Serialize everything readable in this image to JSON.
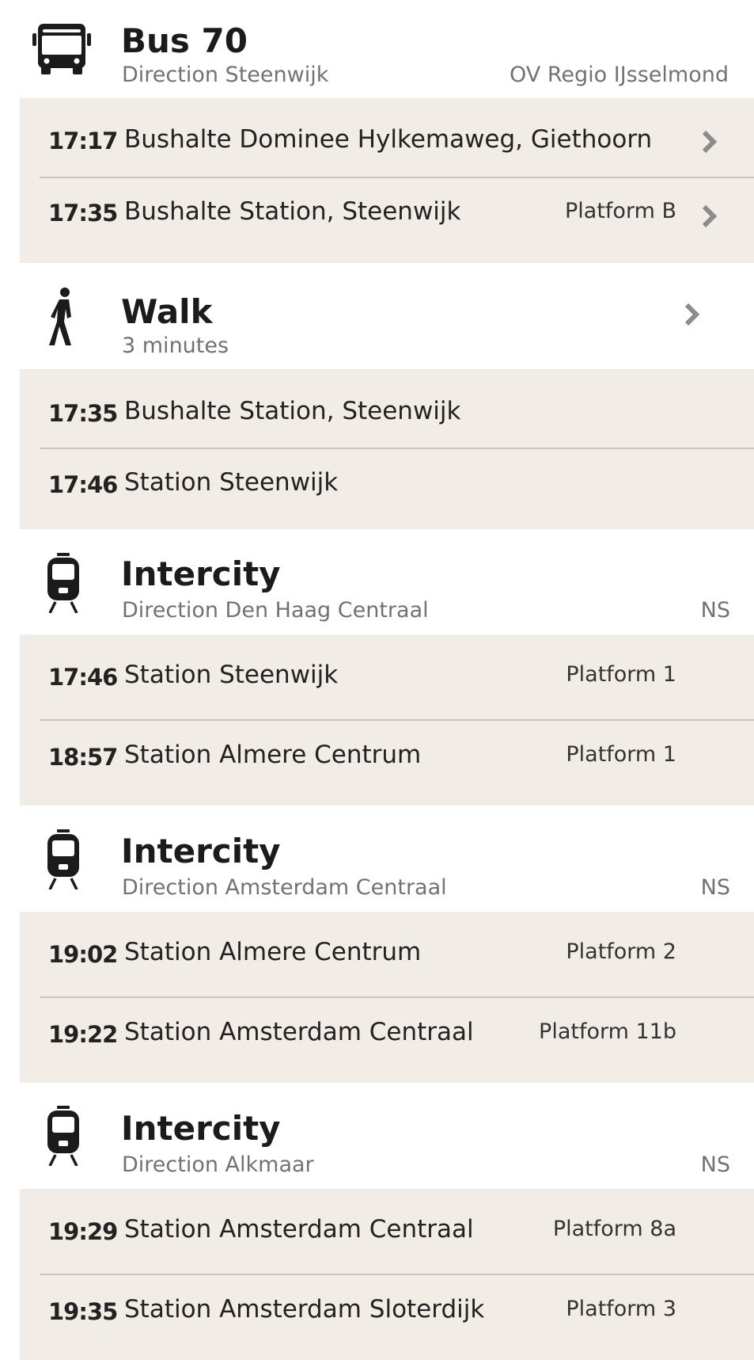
{
  "colors": {
    "stop_background": "#f1ece5",
    "divider": "#c9c4bd",
    "subtext": "#727272",
    "chevron": "#8c8c8c"
  },
  "legs": [
    {
      "icon": "bus-icon",
      "title": "Bus 70",
      "subtitle": "Direction Steenwijk",
      "operator": "OV Regio IJsselmond",
      "stops": [
        {
          "time": "17:17",
          "name": "Bushalte Dominee Hylkemaweg, Giethoorn",
          "platform": "",
          "chevron": true
        },
        {
          "time": "17:35",
          "name": "Bushalte Station, Steenwijk",
          "platform": "Platform B",
          "chevron": true
        }
      ]
    },
    {
      "icon": "walk-icon",
      "title": "Walk",
      "subtitle": "3 minutes",
      "operator": "",
      "stops": [
        {
          "time": "17:35",
          "name": "Bushalte Station, Steenwijk",
          "platform": ""
        },
        {
          "time": "17:46",
          "name": "Station Steenwijk",
          "platform": ""
        }
      ]
    },
    {
      "icon": "train-icon",
      "title": "Intercity",
      "subtitle": "Direction Den Haag Centraal",
      "operator": "NS",
      "stops": [
        {
          "time": "17:46",
          "name": "Station Steenwijk",
          "platform": "Platform 1"
        },
        {
          "time": "18:57",
          "name": "Station Almere Centrum",
          "platform": "Platform 1"
        }
      ]
    },
    {
      "icon": "train-icon",
      "title": "Intercity",
      "subtitle": "Direction Amsterdam Centraal",
      "operator": "NS",
      "stops": [
        {
          "time": "19:02",
          "name": "Station Almere Centrum",
          "platform": "Platform 2"
        },
        {
          "time": "19:22",
          "name": "Station Amsterdam Centraal",
          "platform": "Platform 11b"
        }
      ]
    },
    {
      "icon": "train-icon",
      "title": "Intercity",
      "subtitle": "Direction Alkmaar",
      "operator": "NS",
      "stops": [
        {
          "time": "19:29",
          "name": "Station Amsterdam Centraal",
          "platform": "Platform 8a"
        },
        {
          "time": "19:35",
          "name": "Station Amsterdam Sloterdijk",
          "platform": "Platform 3"
        }
      ]
    }
  ]
}
